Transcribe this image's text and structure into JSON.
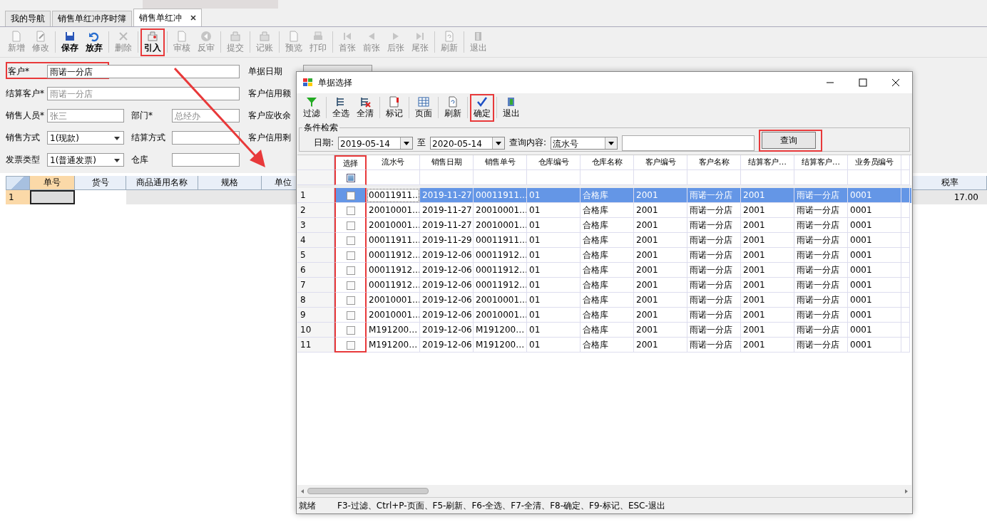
{
  "tabs": [
    {
      "label": "我的导航",
      "selected": false,
      "closable": false
    },
    {
      "label": "销售单红冲序时簿",
      "selected": false,
      "closable": false
    },
    {
      "label": "销售单红冲",
      "selected": true,
      "closable": true
    }
  ],
  "toolbar": [
    {
      "label": "新增",
      "disabled": true,
      "highlighted": false
    },
    {
      "label": "修改",
      "disabled": true,
      "highlighted": false
    },
    {
      "label": "保存",
      "disabled": false,
      "highlighted": false
    },
    {
      "label": "放弃",
      "disabled": false,
      "highlighted": false
    },
    {
      "label": "删除",
      "disabled": true,
      "highlighted": false
    },
    {
      "label": "引入",
      "disabled": false,
      "highlighted": true
    },
    {
      "label": "审核",
      "disabled": true,
      "highlighted": false
    },
    {
      "label": "反审",
      "disabled": true,
      "highlighted": false
    },
    {
      "label": "提交",
      "disabled": true,
      "highlighted": false
    },
    {
      "label": "记账",
      "disabled": true,
      "highlighted": false
    },
    {
      "label": "预览",
      "disabled": true,
      "highlighted": false
    },
    {
      "label": "打印",
      "disabled": true,
      "highlighted": false
    },
    {
      "label": "首张",
      "disabled": true,
      "highlighted": false
    },
    {
      "label": "前张",
      "disabled": true,
      "highlighted": false
    },
    {
      "label": "后张",
      "disabled": true,
      "highlighted": false
    },
    {
      "label": "尾张",
      "disabled": true,
      "highlighted": false
    },
    {
      "label": "刷新",
      "disabled": true,
      "highlighted": false
    },
    {
      "label": "退出",
      "disabled": true,
      "highlighted": false
    }
  ],
  "form": {
    "customer": {
      "label": "客户*",
      "value": "雨诺一分店",
      "highlighted": true
    },
    "settle_customer": {
      "label": "结算客户*",
      "value": "雨诺一分店"
    },
    "salesperson": {
      "label": "销售人员*",
      "value": "张三"
    },
    "department": {
      "label": "部门*",
      "value": "总经办"
    },
    "sale_method": {
      "label": "销售方式",
      "value": "1(现款)"
    },
    "settle_method": {
      "label": "结算方式"
    },
    "invoice_type": {
      "label": "发票类型",
      "value": "1(普通发票)"
    },
    "warehouse": {
      "label": "仓库"
    },
    "doc_date": {
      "label": "单据日期"
    },
    "right_labels": [
      "客户信用额",
      "客户应收余",
      "客户信用剩"
    ]
  },
  "main_grid": {
    "columns": [
      "单号",
      "货号",
      "商品通用名称",
      "规格",
      "单位"
    ],
    "right_column": "税率",
    "row": {
      "no": "1",
      "tax_rate": "17.00"
    }
  },
  "annotation_arrow": true,
  "dialog": {
    "title": "单据选择",
    "toolbar": [
      {
        "label": "过滤",
        "highlighted": false
      },
      {
        "label": "全选",
        "highlighted": false
      },
      {
        "label": "全清",
        "highlighted": false
      },
      {
        "label": "标记",
        "highlighted": false
      },
      {
        "label": "页面",
        "highlighted": false
      },
      {
        "label": "刷新",
        "highlighted": false
      },
      {
        "label": "确定",
        "highlighted": true
      },
      {
        "label": "退出",
        "highlighted": false
      }
    ],
    "criteria": {
      "title": "条件检索",
      "date_label": "日期:",
      "date_from": "2019-05-14",
      "to_label": "至",
      "date_to": "2020-05-14",
      "content_label": "查询内容:",
      "content_value": "流水号",
      "query_button": "查询",
      "query_highlighted": true
    },
    "grid": {
      "select_header": "选择",
      "select_all_indeterminate": true,
      "select_column_highlighted": true,
      "columns": [
        "流水号",
        "销售日期",
        "销售单号",
        "仓库编号",
        "仓库名称",
        "客户编号",
        "客户名称",
        "结算客户…",
        "结算客户…",
        "业务员编号"
      ],
      "rows": [
        {
          "no": "1",
          "checked": false,
          "selected": true,
          "cells": [
            "00011911…",
            "2019-11-27",
            "00011911…",
            "01",
            "合格库",
            "2001",
            "雨诺一分店",
            "2001",
            "雨诺一分店",
            "0001"
          ]
        },
        {
          "no": "2",
          "checked": false,
          "selected": false,
          "cells": [
            "20010001…",
            "2019-11-27",
            "20010001…",
            "01",
            "合格库",
            "2001",
            "雨诺一分店",
            "2001",
            "雨诺一分店",
            "0001"
          ]
        },
        {
          "no": "3",
          "checked": false,
          "selected": false,
          "cells": [
            "20010001…",
            "2019-11-27",
            "20010001…",
            "01",
            "合格库",
            "2001",
            "雨诺一分店",
            "2001",
            "雨诺一分店",
            "0001"
          ]
        },
        {
          "no": "4",
          "checked": false,
          "selected": false,
          "cells": [
            "00011911…",
            "2019-11-29",
            "00011911…",
            "01",
            "合格库",
            "2001",
            "雨诺一分店",
            "2001",
            "雨诺一分店",
            "0001"
          ]
        },
        {
          "no": "5",
          "checked": false,
          "selected": false,
          "cells": [
            "00011912…",
            "2019-12-06",
            "00011912…",
            "01",
            "合格库",
            "2001",
            "雨诺一分店",
            "2001",
            "雨诺一分店",
            "0001"
          ]
        },
        {
          "no": "6",
          "checked": false,
          "selected": false,
          "cells": [
            "00011912…",
            "2019-12-06",
            "00011912…",
            "01",
            "合格库",
            "2001",
            "雨诺一分店",
            "2001",
            "雨诺一分店",
            "0001"
          ]
        },
        {
          "no": "7",
          "checked": false,
          "selected": false,
          "cells": [
            "00011912…",
            "2019-12-06",
            "00011912…",
            "01",
            "合格库",
            "2001",
            "雨诺一分店",
            "2001",
            "雨诺一分店",
            "0001"
          ]
        },
        {
          "no": "8",
          "checked": false,
          "selected": false,
          "cells": [
            "20010001…",
            "2019-12-06",
            "20010001…",
            "01",
            "合格库",
            "2001",
            "雨诺一分店",
            "2001",
            "雨诺一分店",
            "0001"
          ]
        },
        {
          "no": "9",
          "checked": false,
          "selected": false,
          "cells": [
            "20010001…",
            "2019-12-06",
            "20010001…",
            "01",
            "合格库",
            "2001",
            "雨诺一分店",
            "2001",
            "雨诺一分店",
            "0001"
          ]
        },
        {
          "no": "10",
          "checked": false,
          "selected": false,
          "cells": [
            "M191200…",
            "2019-12-06",
            "M191200…",
            "01",
            "合格库",
            "2001",
            "雨诺一分店",
            "2001",
            "雨诺一分店",
            "0001"
          ]
        },
        {
          "no": "11",
          "checked": false,
          "selected": false,
          "cells": [
            "M191200…",
            "2019-12-06",
            "M191200…",
            "01",
            "合格库",
            "2001",
            "雨诺一分店",
            "2001",
            "雨诺一分店",
            "0001"
          ]
        }
      ]
    },
    "status": {
      "state": "就绪",
      "shortcuts": "F3-过滤、Ctrl+P-页面、F5-刷新、F6-全选、F7-全清、F8-确定、F9-标记、ESC-退出"
    }
  }
}
